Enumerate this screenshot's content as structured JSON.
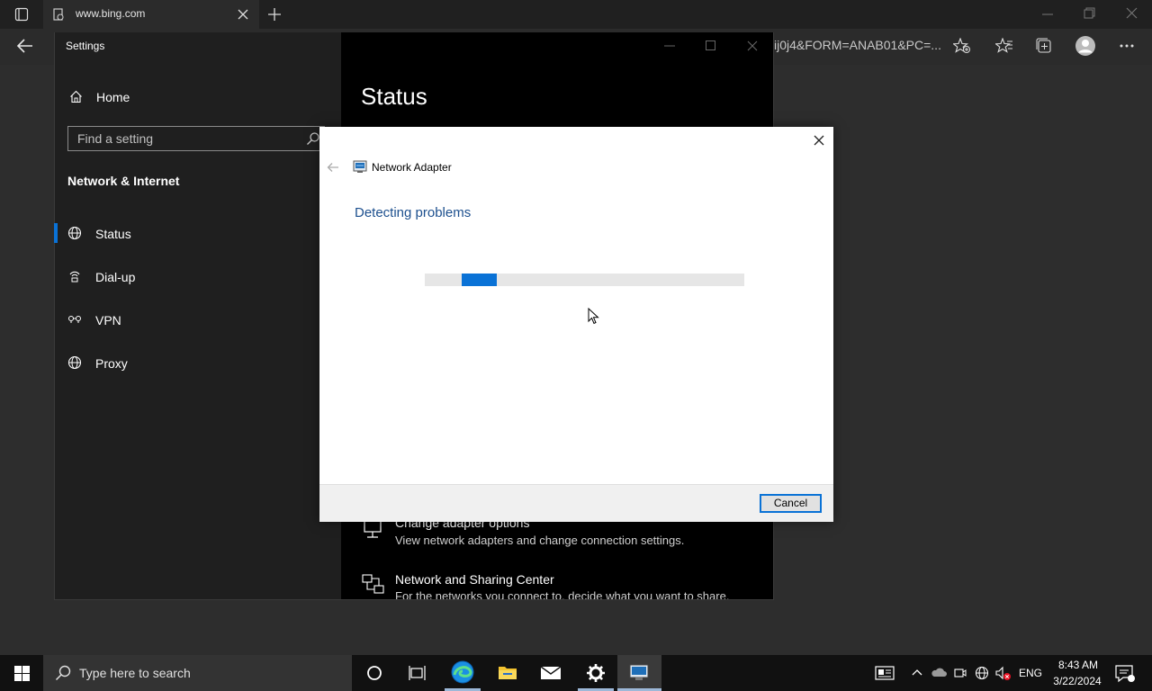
{
  "browser": {
    "tab_title": "www.bing.com",
    "url_tail": "ij0j4&FORM=ANAB01&PC=..."
  },
  "settings": {
    "window_title": "Settings",
    "home_label": "Home",
    "search_placeholder": "Find a setting",
    "section_title": "Network & Internet",
    "nav_items": [
      {
        "label": "Status",
        "icon": "globe-network-icon",
        "selected": true
      },
      {
        "label": "Dial-up",
        "icon": "dialup-icon"
      },
      {
        "label": "VPN",
        "icon": "vpn-icon"
      },
      {
        "label": "Proxy",
        "icon": "globe-icon"
      }
    ],
    "page_title": "Status",
    "links": [
      {
        "title": "Change adapter options",
        "desc": "View network adapters and change connection settings.",
        "icon": "adapter-icon"
      },
      {
        "title": "Network and Sharing Center",
        "desc": "For the networks you connect to, decide what you want to share.",
        "icon": "sharing-center-icon"
      }
    ]
  },
  "dialog": {
    "title": "Network Adapter",
    "heading": "Detecting problems",
    "cancel_label": "Cancel",
    "accent": "#0a72d6"
  },
  "taskbar": {
    "search_placeholder": "Type here to search",
    "language": "ENG",
    "time": "8:43 AM",
    "date": "3/22/2024"
  }
}
